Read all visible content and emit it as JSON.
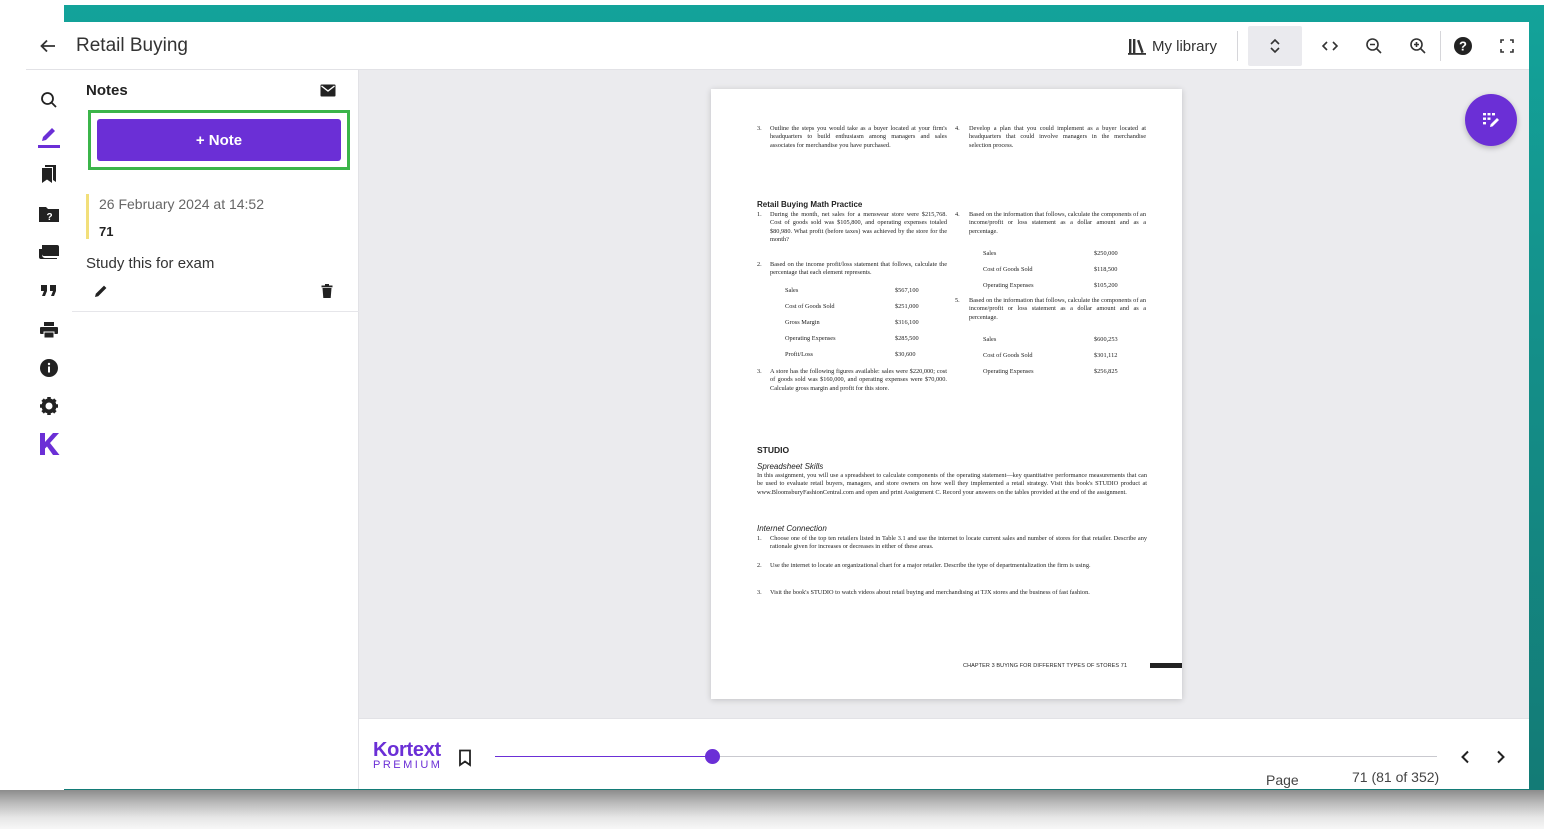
{
  "colors": {
    "accent": "#6b2fd6",
    "highlight_border": "#3bb54a",
    "note_marker": "#f2df7a",
    "teal_backdrop": "#13a39a"
  },
  "header": {
    "title": "Retail Buying",
    "my_library": "My library"
  },
  "notes_panel": {
    "heading": "Notes",
    "add_note_label": "+ Note",
    "notes": [
      {
        "date": "26 February 2024 at 14:52",
        "page": "71",
        "text": "Study this for exam"
      }
    ]
  },
  "document": {
    "q3_num": "3.",
    "q3_text": "Outline the steps you would take as a buyer located at your firm's headquarters to build enthusiasm among managers and sales associates for merchandise you have purchased.",
    "q4_num": "4.",
    "q4_text": "Develop a plan that you could implement as a buyer located at headquarters that could involve managers in the merchandise selection process.",
    "math_heading": "Retail Buying Math Practice",
    "m1_num": "1.",
    "m1_text": "During the month, net sales for a menswear store were $215,768. Cost of goods sold was $105,800, and operating expenses totaled $80,980. What profit (before taxes) was achieved by the store for the month?",
    "m2_num": "2.",
    "m2_text": "Based on the income profit/loss statement that follows, calculate the percentage that each element represents.",
    "m2_table": [
      {
        "label": "Sales",
        "value": "$567,100"
      },
      {
        "label": "Cost of Goods Sold",
        "value": "$251,000"
      },
      {
        "label": "Gross Margin",
        "value": "$316,100"
      },
      {
        "label": "Operating Expenses",
        "value": "$285,500"
      },
      {
        "label": "Profit/Loss",
        "value": "$30,600"
      }
    ],
    "m3_num": "3.",
    "m3_text": "A store has the following figures available: sales were $220,000; cost of goods sold was $160,000, and operating expenses were $70,000. Calculate gross margin and profit for this store.",
    "m4_num": "4.",
    "m4_text": "Based on the information that follows, calculate the components of an income/profit or loss statement as a dollar amount and as a percentage.",
    "m4_table": [
      {
        "label": "Sales",
        "value": "$250,000"
      },
      {
        "label": "Cost of Goods Sold",
        "value": "$118,500"
      },
      {
        "label": "Operating Expenses",
        "value": "$105,200"
      }
    ],
    "m5_num": "5.",
    "m5_text": "Based on the information that follows, calculate the components of an income/profit or loss statement as a dollar amount and as a percentage.",
    "m5_table": [
      {
        "label": "Sales",
        "value": "$600,253"
      },
      {
        "label": "Cost of Goods Sold",
        "value": "$301,112"
      },
      {
        "label": "Operating Expenses",
        "value": "$256,825"
      }
    ],
    "studio_heading": "STUDIO",
    "spreadsheet_heading": "Spreadsheet Skills",
    "spreadsheet_text": "In this assignment, you will use a spreadsheet to calculate components of the operating statement—key quantitative performance measurements that can be used to evaluate retail buyers, managers, and store owners on how well they implemented a retail strategy. Visit this book's STUDIO product at www.BloomsburyFashionCentral.com and open and print Assignment C. Record your answers on the tables provided at the end of the assignment.",
    "internet_heading": "Internet Connection",
    "i1_num": "1.",
    "i1_text": "Choose one of the top ten retailers listed in Table 3.1 and use the internet to locate current sales and number of stores for that retailer. Describe any rationale given for increases or decreases in either of these areas.",
    "i2_num": "2.",
    "i2_text": "Use the internet to locate an organizational chart for a major retailer. Describe the type of departmentalization the firm is using.",
    "i3_num": "3.",
    "i3_text": "Visit the book's STUDIO to watch videos about retail buying and merchandising at TJX stores and the business of fast fashion.",
    "footer": "CHAPTER 3  BUYING FOR DIFFERENT TYPES OF STORES   71"
  },
  "bottom_bar": {
    "brand_name": "Kortext",
    "brand_sub": "PREMIUM",
    "page_label": "Page",
    "page_value": "71 (81 of 352)",
    "progress": 0.23
  },
  "icons": {
    "rail": [
      "search-icon",
      "notes-pen-icon",
      "bookmarks-icon",
      "folder-question-icon",
      "flashcards-icon",
      "quote-icon",
      "print-icon",
      "info-icon",
      "settings-icon",
      "kortext-k-logo"
    ],
    "top": [
      "back-arrow-icon",
      "library-icon",
      "scroll-vertical-icon",
      "code-arrows-icon",
      "zoom-out-icon",
      "zoom-in-icon",
      "help-icon",
      "fullscreen-icon"
    ]
  }
}
